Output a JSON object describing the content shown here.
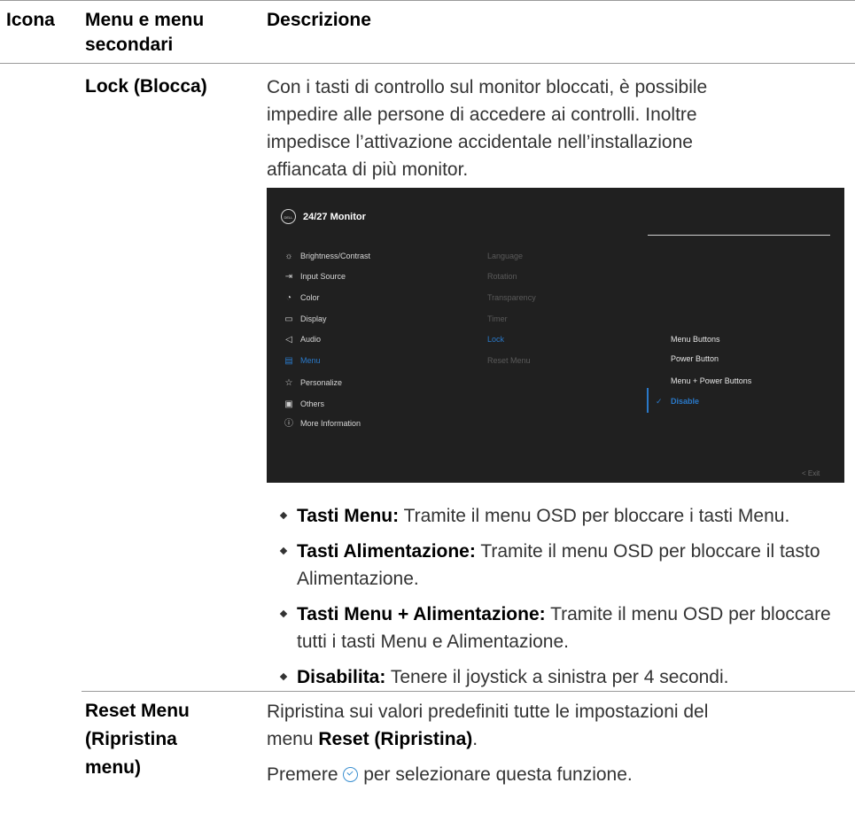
{
  "table_header": {
    "col_icon": "Icona",
    "col_menu_line1": "Menu e menu",
    "col_menu_line2": "secondari",
    "col_desc": "Descrizione"
  },
  "lock_row": {
    "name": "Lock (Blocca)",
    "desc_lines": [
      "Con i tasti di controllo sul monitor bloccati, è possibile",
      "impedire alle persone di accedere ai controlli. Inoltre",
      "impedisce l’attivazione accidentale nell’installazione",
      "affiancata di più monitor."
    ]
  },
  "osd": {
    "logo": "DELL",
    "title": "24/27 Monitor",
    "menu": [
      {
        "icon": "brightness-icon",
        "glyph": "☼",
        "label": "Brightness/Contrast",
        "active": false
      },
      {
        "icon": "input-source-icon",
        "glyph": "⇥",
        "label": "Input Source",
        "active": false
      },
      {
        "icon": "color-icon",
        "glyph": "◔",
        "label": "Color",
        "active": false
      },
      {
        "icon": "display-icon",
        "glyph": "▭",
        "label": "Display",
        "active": false
      },
      {
        "icon": "audio-icon",
        "glyph": "◁",
        "label": "Audio",
        "active": false
      },
      {
        "icon": "menu-icon",
        "glyph": "▤",
        "label": "Menu",
        "active": true
      },
      {
        "icon": "personalize-icon",
        "glyph": "☆",
        "label": "Personalize",
        "active": false
      },
      {
        "icon": "others-icon",
        "glyph": "▣",
        "label": "Others",
        "active": false
      },
      {
        "icon": "info-icon",
        "glyph": "ⓘ",
        "label": "More Information",
        "active": false
      }
    ],
    "submenu": [
      {
        "label": "Language",
        "active": false
      },
      {
        "label": "Rotation",
        "active": false
      },
      {
        "label": "Transparency",
        "active": false
      },
      {
        "label": "Timer",
        "active": false
      },
      {
        "label": "Lock",
        "active": true
      },
      {
        "label": "Reset Menu",
        "active": false
      }
    ],
    "options": [
      {
        "label": "Menu Buttons",
        "active": false
      },
      {
        "label": "Power Button",
        "active": false
      },
      {
        "label": "Menu + Power Buttons",
        "active": false
      },
      {
        "label": "Disable",
        "active": true
      }
    ],
    "check_glyph": "✓",
    "exit_label": "<  Exit"
  },
  "bullets": [
    {
      "bold": "Tasti Menu:",
      "text": " Tramite il menu OSD per bloccare i tasti Menu."
    },
    {
      "bold": "Tasti Alimentazione:",
      "text": " Tramite il menu OSD per bloccare il tasto Alimentazione."
    },
    {
      "bold": "Tasti Menu + Alimentazione:",
      "text": " Tramite il menu OSD per bloccare tutti i tasti Menu e Alimentazione."
    },
    {
      "bold": "Disabilita:",
      "text": " Tenere il joystick a sinistra per 4 secondi."
    }
  ],
  "reset_row": {
    "name_lines": [
      "Reset Menu",
      "(Ripristina",
      "menu)"
    ],
    "desc_line1": "Ripristina sui valori predefiniti tutte le impostazioni del",
    "desc_line2_pre": "menu ",
    "desc_line2_bold": "Reset (Ripristina)",
    "desc_line2_post": ".",
    "press_pre": "Premere ",
    "press_post": " per selezionare questa funzione."
  }
}
